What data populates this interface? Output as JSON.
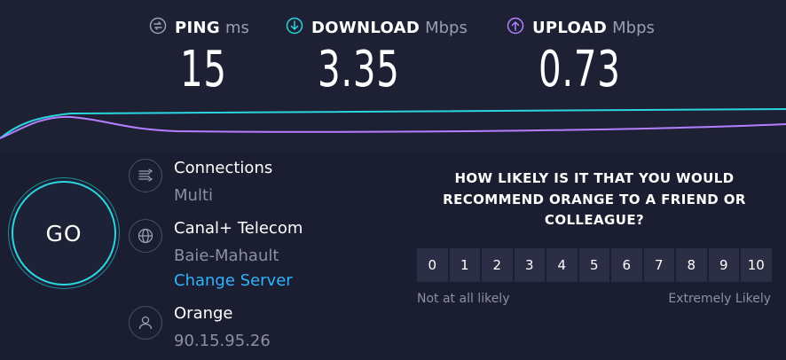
{
  "metrics": {
    "ping": {
      "label": "PING",
      "unit": "ms",
      "value": "15",
      "icon": "ping-icon",
      "color": "#9a9db3"
    },
    "download": {
      "label": "DOWNLOAD",
      "unit": "Mbps",
      "value": "3.35",
      "icon": "download-arrow-icon",
      "color": "#2ad6e0"
    },
    "upload": {
      "label": "UPLOAD",
      "unit": "Mbps",
      "value": "0.73",
      "icon": "upload-arrow-icon",
      "color": "#b480ff"
    }
  },
  "go_button": {
    "label": "GO"
  },
  "connections": {
    "title": "Connections",
    "value": "Multi",
    "icon": "connections-icon"
  },
  "server": {
    "title": "Canal+ Telecom",
    "location": "Baie-Mahault",
    "change_link": "Change Server",
    "icon": "globe-icon"
  },
  "provider": {
    "title": "Orange",
    "ip": "90.15.95.26",
    "icon": "user-icon"
  },
  "survey": {
    "question_lines": [
      "HOW LIKELY IS IT THAT YOU WOULD",
      "RECOMMEND ORANGE TO A FRIEND OR",
      "COLLEAGUE?"
    ],
    "options": [
      "0",
      "1",
      "2",
      "3",
      "4",
      "5",
      "6",
      "7",
      "8",
      "9",
      "10"
    ],
    "low_label": "Not at all likely",
    "high_label": "Extremely Likely"
  }
}
